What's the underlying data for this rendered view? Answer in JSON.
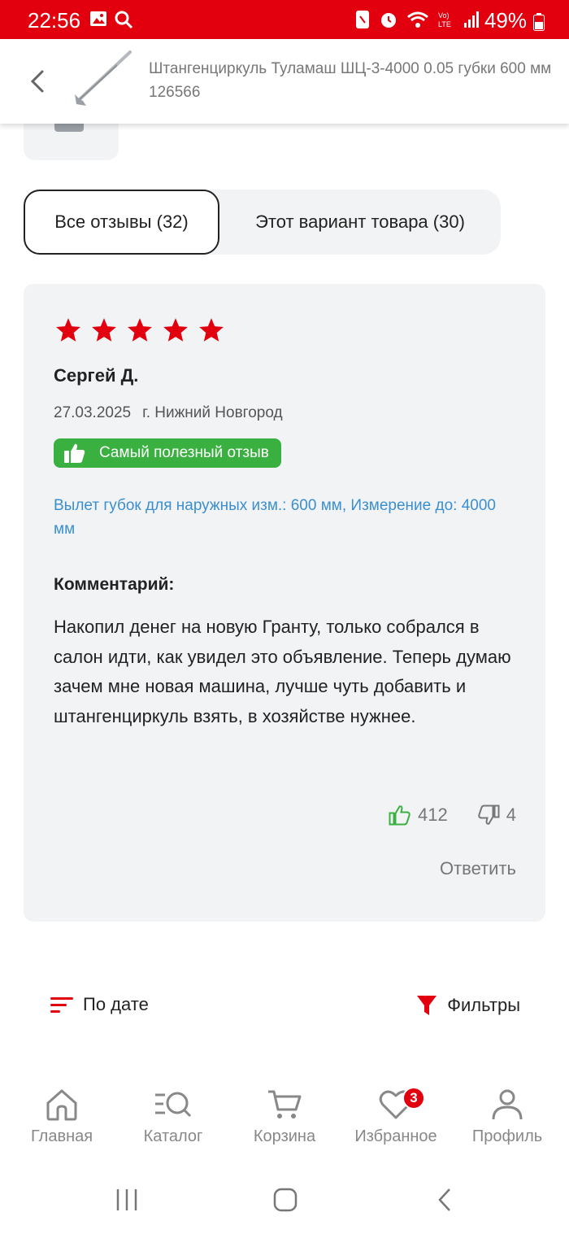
{
  "status_bar": {
    "time": "22:56",
    "battery": "49%"
  },
  "header": {
    "title": "Штангенциркуль Туламаш ШЦ-3-4000 0.05 губки 600 мм 126566"
  },
  "tabs": [
    {
      "label": "Все отзывы (32)",
      "active": true
    },
    {
      "label": "Этот вариант товара (30)",
      "active": false
    }
  ],
  "review": {
    "rating": 5,
    "author": "Сергей Д.",
    "date": "27.03.2025",
    "city": "г. Нижний Новгород",
    "badge": "Самый полезный отзыв",
    "variant": "Вылет губок для наружных изм.: 600 мм, Измерение до: 4000 мм",
    "comment_heading": "Комментарий:",
    "comment": "Накопил денег на новую Гранту, только собрался в салон идти, как увидел это объявление. Теперь думаю зачем мне новая машина, лучше чуть добавить и штангенциркуль взять, в хозяйстве нужнее.",
    "likes": "412",
    "dislikes": "4",
    "reply_label": "Ответить"
  },
  "controls": {
    "sort_label": "По дате",
    "filter_label": "Фильтры"
  },
  "bottom_nav": {
    "items": [
      {
        "label": "Главная",
        "icon": "home-icon"
      },
      {
        "label": "Каталог",
        "icon": "catalog-search-icon"
      },
      {
        "label": "Корзина",
        "icon": "cart-icon"
      },
      {
        "label": "Избранное",
        "icon": "heart-icon",
        "badge": "3"
      },
      {
        "label": "Профиль",
        "icon": "profile-icon"
      }
    ]
  },
  "colors": {
    "brand": "#e2000f",
    "success": "#3ab041",
    "link": "#3b8fd0",
    "card": "#f2f3f5"
  }
}
